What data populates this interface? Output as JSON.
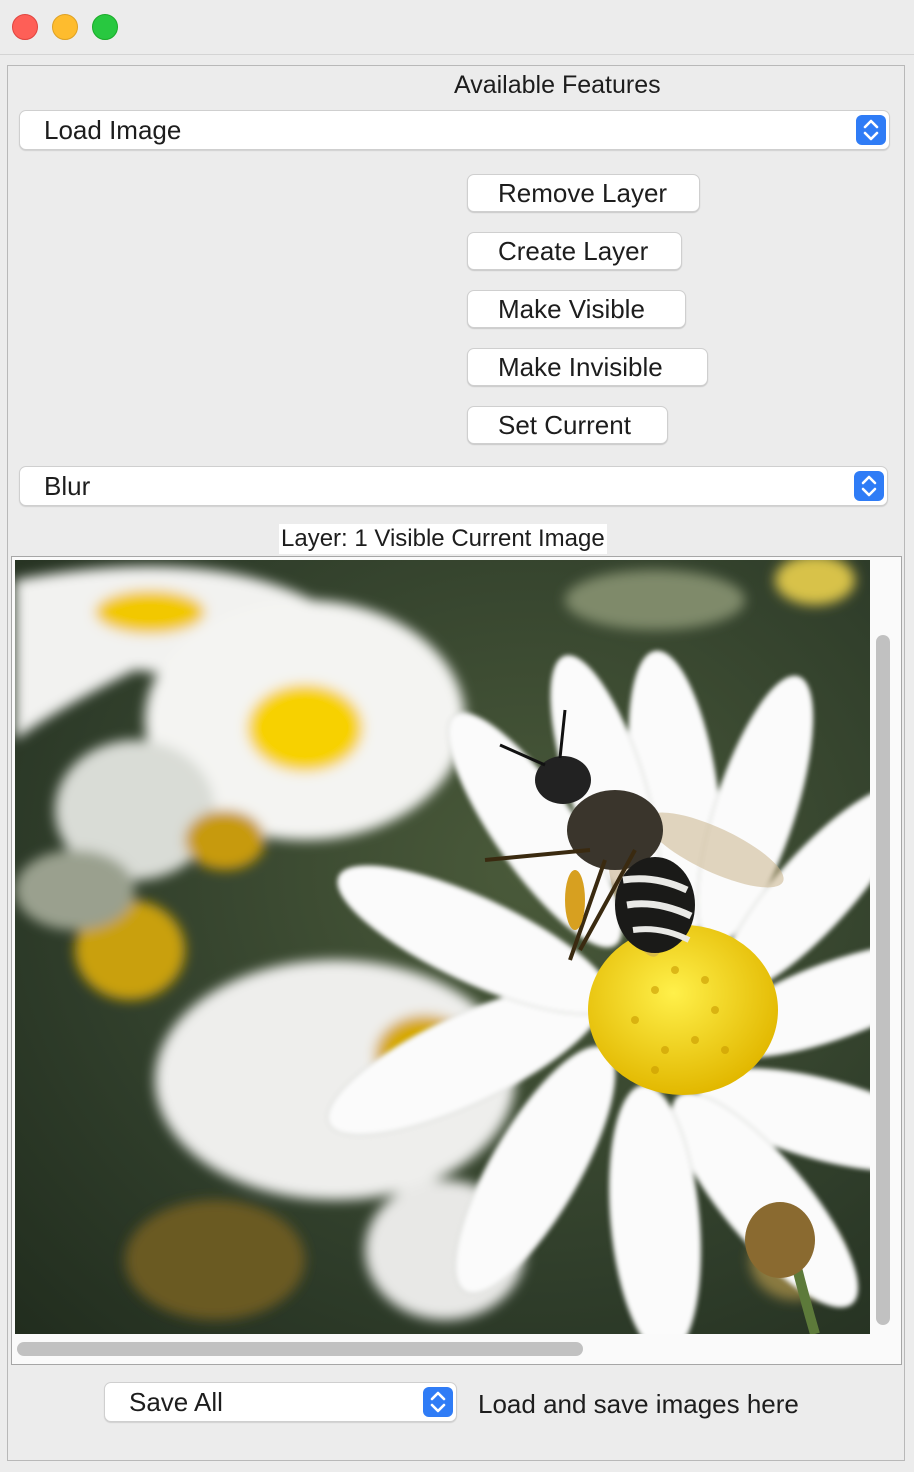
{
  "window": {
    "close": "close",
    "minimize": "minimize",
    "maximize": "maximize"
  },
  "header": {
    "title": "Available Features"
  },
  "feature_select": {
    "value": "Load Image"
  },
  "layer_buttons": {
    "remove": "Remove Layer",
    "create": "Create Layer",
    "visible": "Make Visible",
    "invisible": "Make Invisible",
    "current": "Set Current"
  },
  "filter_select": {
    "value": "Blur"
  },
  "layer_info": {
    "text": "Layer: 1 Visible Current Image"
  },
  "image": {
    "subject": "bee on white daisy"
  },
  "footer": {
    "save_select": "Save All",
    "label": "Load and save images here"
  },
  "colors": {
    "accent": "#2f7cf6",
    "close": "#fe5f57",
    "minimize": "#febc2e",
    "maximize": "#28c840"
  }
}
